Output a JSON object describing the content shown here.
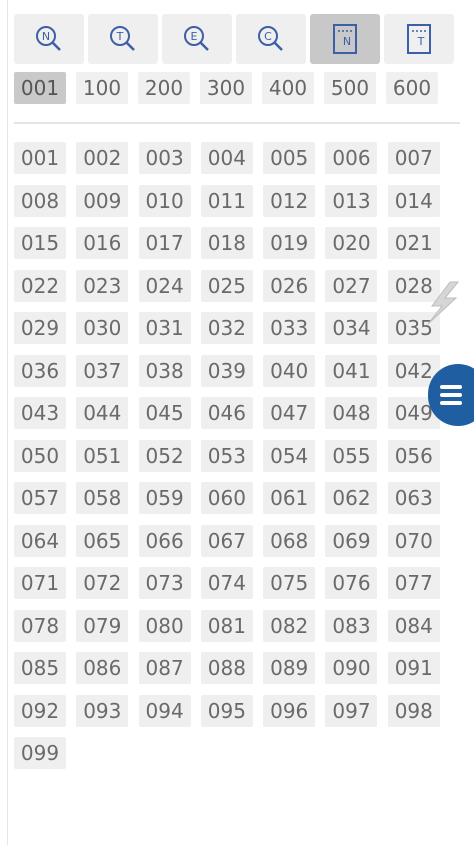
{
  "toolbar": {
    "items": [
      {
        "name": "n-search",
        "glyph": "N"
      },
      {
        "name": "t-search",
        "glyph": "T"
      },
      {
        "name": "e-search",
        "glyph": "E"
      },
      {
        "name": "c-search",
        "glyph": "C"
      },
      {
        "name": "n-page",
        "glyph": "N",
        "active": true
      },
      {
        "name": "t-page",
        "glyph": "T"
      }
    ]
  },
  "hundreds": {
    "selected": "001",
    "items": [
      "001",
      "100",
      "200",
      "300",
      "400",
      "500",
      "600"
    ]
  },
  "grid": {
    "numbers": [
      "001",
      "002",
      "003",
      "004",
      "005",
      "006",
      "007",
      "008",
      "009",
      "010",
      "011",
      "012",
      "013",
      "014",
      "015",
      "016",
      "017",
      "018",
      "019",
      "020",
      "021",
      "022",
      "023",
      "024",
      "025",
      "026",
      "027",
      "028",
      "029",
      "030",
      "031",
      "032",
      "033",
      "034",
      "035",
      "036",
      "037",
      "038",
      "039",
      "040",
      "041",
      "042",
      "043",
      "044",
      "045",
      "046",
      "047",
      "048",
      "049",
      "050",
      "051",
      "052",
      "053",
      "054",
      "055",
      "056",
      "057",
      "058",
      "059",
      "060",
      "061",
      "062",
      "063",
      "064",
      "065",
      "066",
      "067",
      "068",
      "069",
      "070",
      "071",
      "072",
      "073",
      "074",
      "075",
      "076",
      "077",
      "078",
      "079",
      "080",
      "081",
      "082",
      "083",
      "084",
      "085",
      "086",
      "087",
      "088",
      "089",
      "090",
      "091",
      "092",
      "093",
      "094",
      "095",
      "096",
      "097",
      "098",
      "099"
    ]
  },
  "colors": {
    "accent": "#1f5ea1",
    "button_bg": "#efefef",
    "button_active_bg": "#c9c9c9"
  }
}
